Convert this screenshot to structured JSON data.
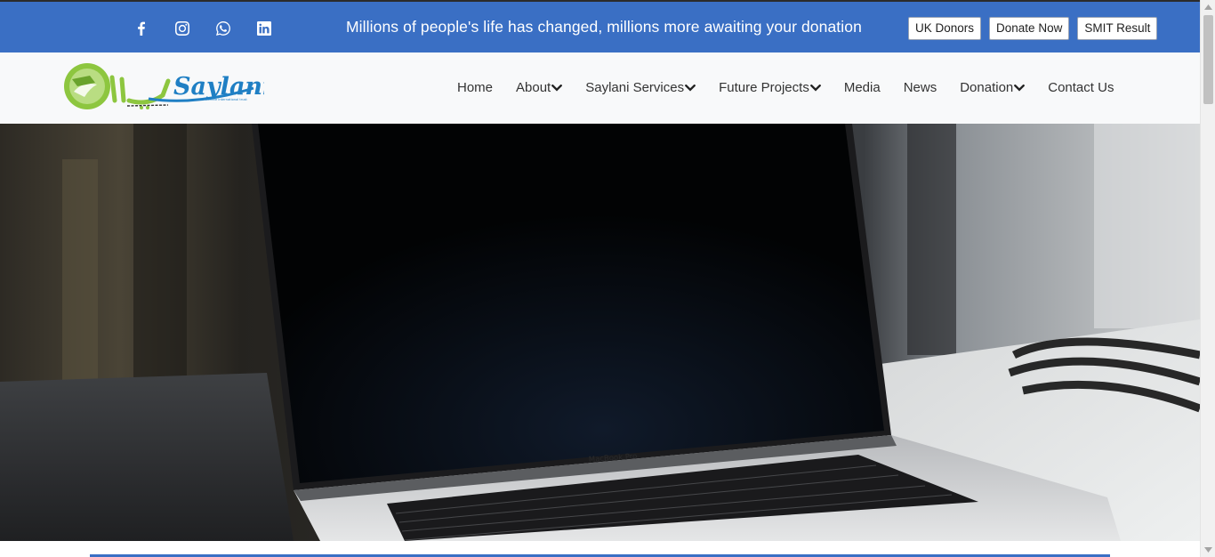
{
  "topbar": {
    "social_icons": [
      "facebook-icon",
      "instagram-icon",
      "whatsapp-icon",
      "linkedin-icon"
    ],
    "tagline": "Millions of people's life has changed, millions more awaiting your donation",
    "buttons": {
      "uk_donors": "UK Donors",
      "donate_now": "Donate Now",
      "smit_result": "SMIT Result"
    }
  },
  "navbar": {
    "logo_text": "Saylani",
    "logo_subtext": "welfare international trust",
    "items": [
      {
        "label": "Home",
        "dropdown": false
      },
      {
        "label": "About",
        "dropdown": true
      },
      {
        "label": "Saylani Services",
        "dropdown": true
      },
      {
        "label": "Future Projects",
        "dropdown": true
      },
      {
        "label": "Media",
        "dropdown": false
      },
      {
        "label": "News",
        "dropdown": false
      },
      {
        "label": "Donation",
        "dropdown": true
      },
      {
        "label": "Contact Us",
        "dropdown": false
      }
    ]
  },
  "hero": {
    "laptop_label": "MacBook Pro"
  },
  "colors": {
    "brand_blue": "#3a6fc4",
    "logo_green": "#8dc63f",
    "logo_blue": "#1f7fc4"
  }
}
